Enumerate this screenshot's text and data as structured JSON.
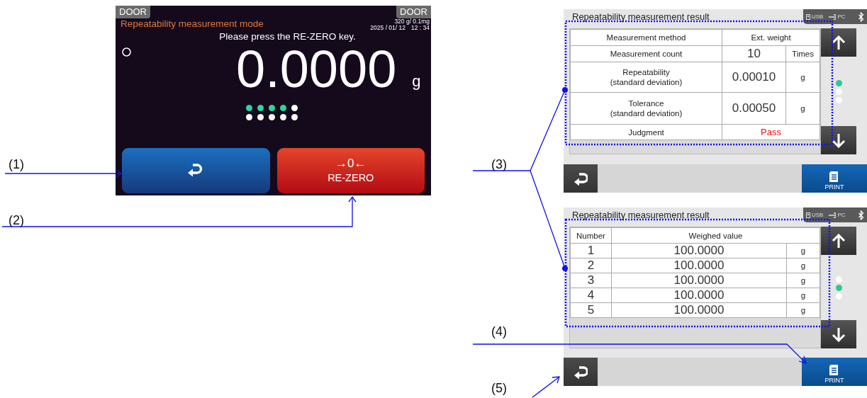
{
  "callouts": [
    {
      "label": "(1)"
    },
    {
      "label": "(2)"
    },
    {
      "label": "(3)"
    },
    {
      "label": "(4)"
    },
    {
      "label": "(5)"
    }
  ],
  "weighing_screen": {
    "door_left": "DOOR",
    "door_right": "DOOR",
    "mode": "Repeatability measurement mode",
    "capacity": "320 g/ 0.1mg",
    "date": "2025 / 01/ 12",
    "time": "12 : 34",
    "message": "Please press the RE-ZERO key.",
    "weight": "0.0000",
    "unit": "g",
    "progress": {
      "level": 0.4
    },
    "rezero_symbol": "→0←",
    "rezero_label": "RE-ZERO"
  },
  "result_screens": [
    {
      "kind": "summary",
      "title": "Repeatability measurement result",
      "status": {
        "usb": "USB",
        "pc": "PC"
      },
      "rows": [
        {
          "kind": "span",
          "label": "Measurement method",
          "value": "Ext. weight"
        },
        {
          "kind": "unit",
          "label": "Measurement count",
          "value": "10",
          "unit": "Times"
        },
        {
          "kind": "unit",
          "label": "Repeatability\n(standard deviation)",
          "value": "0.00010",
          "unit": "g"
        },
        {
          "kind": "unit",
          "label": "Tolerance\n(standard deviation)",
          "value": "0.00050",
          "unit": "g"
        },
        {
          "kind": "judgment",
          "label": "Judgment",
          "value": "Pass"
        }
      ],
      "page_dots": [
        {
          "selected": true
        },
        {
          "selected": false
        },
        {
          "selected": false
        }
      ],
      "print_label": "PRINT"
    },
    {
      "kind": "list",
      "title": "Repeatability measurement result",
      "status": {
        "usb": "USB",
        "pc": "PC"
      },
      "header": [
        "Number",
        "Weighed value"
      ],
      "rows": [
        {
          "number": "1",
          "value": "100.0000",
          "unit": "g"
        },
        {
          "number": "2",
          "value": "100.0000",
          "unit": "g"
        },
        {
          "number": "3",
          "value": "100.0000",
          "unit": "g"
        },
        {
          "number": "4",
          "value": "100.0000",
          "unit": "g"
        },
        {
          "number": "5",
          "value": "100.0000",
          "unit": "g"
        }
      ],
      "page_dots": [
        {
          "selected": false
        },
        {
          "selected": true
        },
        {
          "selected": false
        }
      ],
      "print_label": "PRINT"
    }
  ]
}
